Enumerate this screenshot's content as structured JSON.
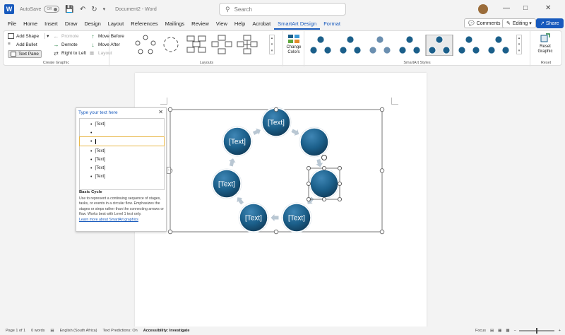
{
  "titlebar": {
    "autosave_label": "AutoSave",
    "autosave_state": "Off",
    "doc_title": "Document2 - Word",
    "search_placeholder": "Search"
  },
  "menu": {
    "tabs": [
      "File",
      "Home",
      "Insert",
      "Draw",
      "Design",
      "Layout",
      "References",
      "Mailings",
      "Review",
      "View",
      "Help",
      "Acrobat",
      "SmartArt Design",
      "Format"
    ],
    "active_tab": "SmartArt Design",
    "comments_label": "Comments",
    "editing_label": "Editing",
    "share_label": "Share"
  },
  "ribbon": {
    "create_graphic": {
      "add_shape": "Add Shape",
      "add_bullet": "Add Bullet",
      "text_pane": "Text Pane",
      "promote": "Promote",
      "demote": "Demote",
      "right_to_left": "Right to Left",
      "move_up": "Move Before",
      "move_down": "Move After",
      "layout": "Layout",
      "group_label": "Create Graphic"
    },
    "layouts_label": "Layouts",
    "change_colors": [
      "Change",
      "Colors"
    ],
    "styles_label": "SmartArt Styles",
    "reset_graphic": [
      "Reset",
      "Graphic"
    ],
    "reset_label": "Reset"
  },
  "text_pane": {
    "title": "Type your text here",
    "items": [
      "[Text]",
      "",
      "",
      "[Text]",
      "[Text]",
      "[Text]",
      "[Text]"
    ],
    "desc_title": "Basic Cycle",
    "desc_body": "Use to represent a continuing sequence of stages, tasks, or events in a circular flow. Emphasizes the stages or steps rather than the connecting arrows or flow. Works best with Level 1 text only.",
    "learn_more": "Learn more about SmartArt graphics"
  },
  "smartart": {
    "node_labels": [
      "[Text]",
      "",
      "",
      "[Text]",
      "[Text]",
      "[Text]",
      "[Text]"
    ],
    "node_color": "#1b5f8a"
  },
  "status": {
    "page": "Page 1 of 1",
    "words": "0 words",
    "language": "English (South Africa)",
    "predictions": "Text Predictions: On",
    "accessibility": "Accessibility: Investigate",
    "focus": "Focus"
  },
  "colors": {
    "accent": "#185abd",
    "node_fill": "#1b5f8a",
    "arrow": "#b9c7d3"
  }
}
